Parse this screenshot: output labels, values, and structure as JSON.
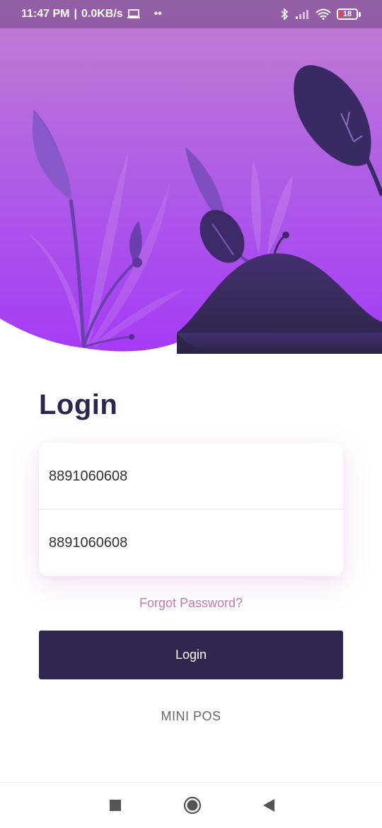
{
  "status_bar": {
    "time": "11:47 PM",
    "separator": "|",
    "network_speed": "0.0KB/s",
    "more": "••",
    "battery_level": "18",
    "icons": [
      "laptop-icon",
      "bluetooth-icon",
      "signal-icon",
      "wifi-icon",
      "battery-icon"
    ]
  },
  "login": {
    "title": "Login",
    "username_value": "8891060608",
    "password_value": "8891060608",
    "forgot_password": "Forgot Password?",
    "login_button": "Login"
  },
  "footer": {
    "brand": "MINI POS"
  },
  "nav_bar": {
    "icons": [
      "recent-apps-icon",
      "home-icon",
      "back-icon"
    ]
  },
  "colors": {
    "gradient_top": "#c27fd0",
    "gradient_bottom": "#a63bf6",
    "dark_purple": "#30264f",
    "forgot_link": "#c07ab8",
    "brand_text": "#6b6478"
  }
}
